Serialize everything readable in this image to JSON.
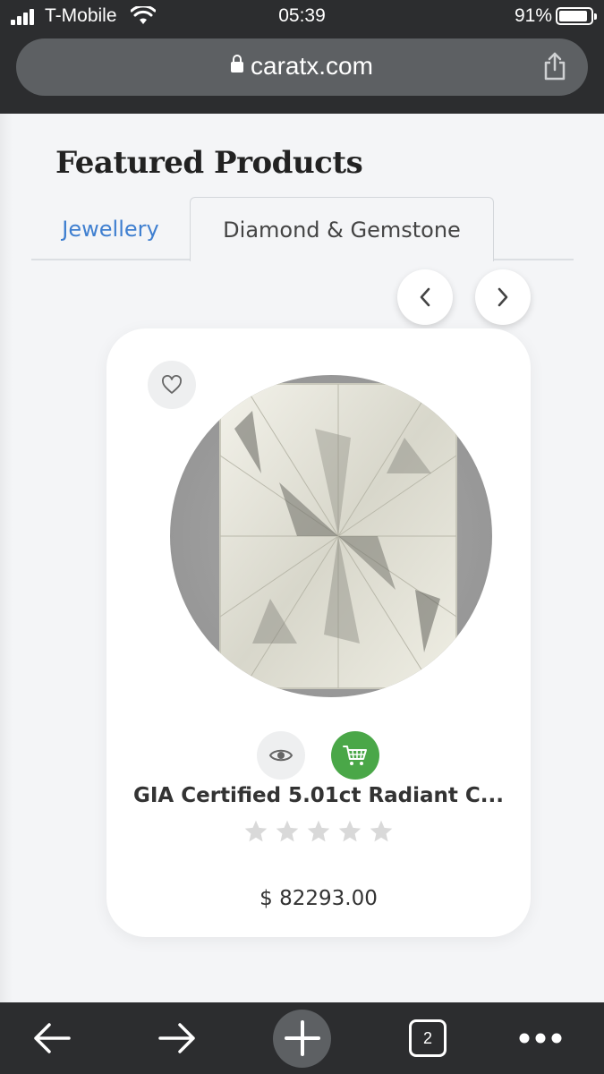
{
  "status_bar": {
    "carrier": "T-Mobile",
    "time": "05:39",
    "battery": "91%",
    "battery_level": 0.91
  },
  "url_bar": {
    "url": "caratx.com"
  },
  "section": {
    "title": "Featured Products"
  },
  "tabs": [
    {
      "label": "Jewellery",
      "active": false
    },
    {
      "label": "Diamond & Gemstone",
      "active": true
    }
  ],
  "carousel": {
    "prev_icon": "chevron-left-icon",
    "next_icon": "chevron-right-icon"
  },
  "product": {
    "title": "GIA Certified 5.01ct Radiant C...",
    "price": "$ 82293.00",
    "rating": 0,
    "max_rating": 5
  },
  "colors": {
    "accent_blue": "#3f7fd0",
    "cart_green": "#4aa748",
    "chrome_dark": "#2c2d2f"
  },
  "toolbar": {
    "tab_count": "2"
  }
}
